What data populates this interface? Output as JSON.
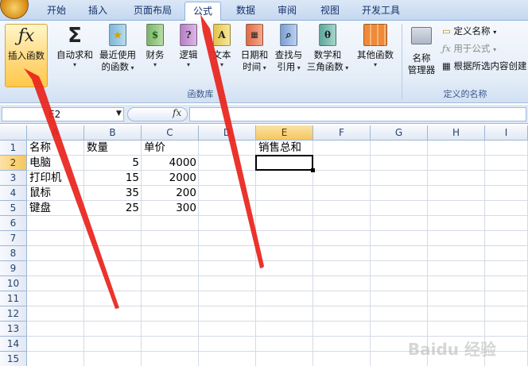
{
  "tabs": [
    "开始",
    "插入",
    "页面布局",
    "公式",
    "数据",
    "审阅",
    "视图",
    "开发工具"
  ],
  "active_tab": "公式",
  "ribbon": {
    "function_library": {
      "label": "函数库",
      "insert_function": "插入函数",
      "autosum": [
        "自动求和"
      ],
      "recent": [
        "最近使用",
        "的函数"
      ],
      "financial": [
        "财务"
      ],
      "logical": [
        "逻辑"
      ],
      "text": [
        "文本"
      ],
      "datetime": [
        "日期和",
        "时间"
      ],
      "lookup": [
        "查找与",
        "引用"
      ],
      "math": [
        "数学和",
        "三角函数"
      ],
      "more": [
        "其他函数"
      ]
    },
    "defined_names": {
      "label": "定义的名称",
      "name_manager": [
        "名称",
        "管理器"
      ],
      "define_name": "定义名称",
      "use_in_formula": "用于公式",
      "create_from_selection": "根据所选内容创建"
    }
  },
  "formula_bar": {
    "name_box": "E2",
    "fx": "fx",
    "formula": ""
  },
  "sheet": {
    "columns": [
      "A",
      "B",
      "C",
      "D",
      "E",
      "F",
      "G",
      "H",
      "I"
    ],
    "rows": [
      "1",
      "2",
      "3",
      "4",
      "5",
      "6",
      "7",
      "8",
      "9",
      "10",
      "11",
      "12",
      "13",
      "14",
      "15"
    ],
    "selected_column": "E",
    "selected_row": "2",
    "cells": {
      "A1": "名称",
      "B1": "数量",
      "C1": "单价",
      "E1": "销售总和",
      "A2": "电脑",
      "B2": "5",
      "C2": "4000",
      "A3": "打印机",
      "B3": "15",
      "C3": "2000",
      "A4": "鼠标",
      "B4": "35",
      "C4": "200",
      "A5": "键盘",
      "B5": "25",
      "C5": "300"
    }
  },
  "watermark": "Baidu 经验",
  "colors": {
    "annotation_arrow": "#e8231b",
    "active_tab_bg": "#ffffff",
    "highlight_button": "#ffd77a"
  }
}
